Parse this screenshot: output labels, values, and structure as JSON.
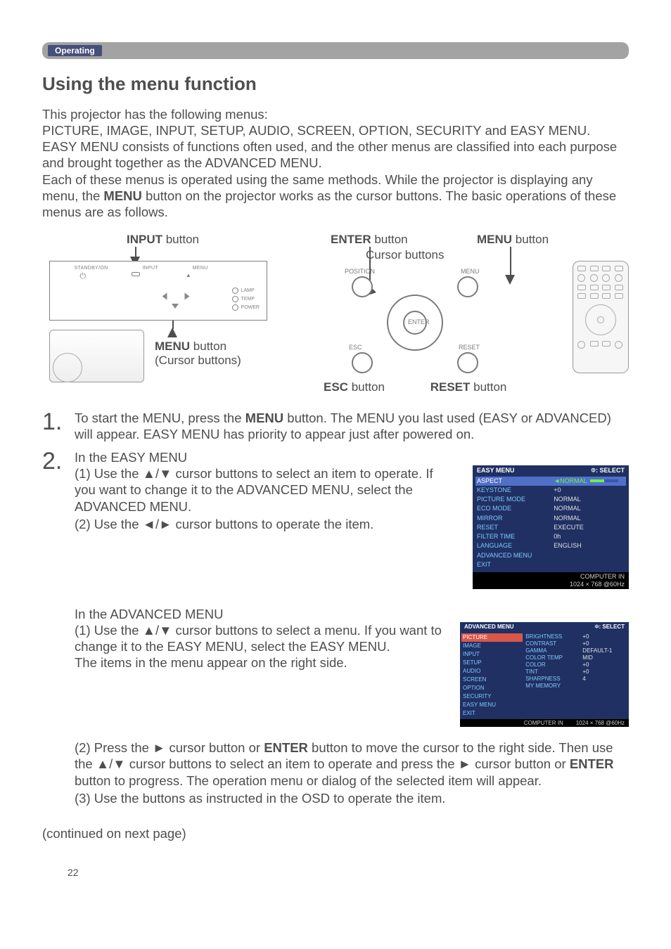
{
  "section_tag": "Operating",
  "title": "Using the menu function",
  "intro": "This projector has the following menus:\nPICTURE, IMAGE, INPUT, SETUP, AUDIO, SCREEN, OPTION, SECURITY and EASY MENU.\nEASY MENU consists of functions often used, and the other menus are classified into each purpose and brought together as the ADVANCED MENU.\nEach of these menus is operated using the same methods. While the projector is displaying any menu, the MENU button on the projector works as the cursor buttons. The basic operations of these menus are as follows.",
  "labels": {
    "input_btn": "INPUT",
    "input_suffix": " button",
    "enter_btn": "ENTER",
    "enter_suffix": " button",
    "menu_btn": "MENU",
    "menu_suffix": " button",
    "cursor_buttons": "Cursor buttons",
    "menu_cursor_line1": "MENU",
    "menu_cursor_suffix": " button",
    "menu_cursor_line2": "(Cursor buttons)",
    "esc_btn": "ESC",
    "esc_suffix": " button",
    "reset_btn": "RESET",
    "reset_suffix": " button"
  },
  "panel": {
    "standby": "STANDBY/ON",
    "input": "INPUT",
    "menu": "MENU",
    "lamp": "LAMP",
    "temp": "TEMP",
    "power": "POWER"
  },
  "cursor_diag": {
    "position": "POSITION",
    "menu": "MENU",
    "enter": "ENTER",
    "esc": "ESC",
    "reset": "RESET"
  },
  "step1_num": "1.",
  "step1_text_pre": "To start the MENU, press the ",
  "step1_text_bold": "MENU",
  "step1_text_post": " button. The MENU you last used (EASY or ADVANCED) will appear. EASY MENU has priority to appear just after powered on.",
  "step2_num": "2.",
  "easy_heading": "In the EASY MENU",
  "easy_1": "(1) Use the ▲/▼ cursor buttons to select an item to operate. If you want to change it to the ADVANCED MENU, select the ADVANCED MENU.",
  "easy_2": "(2) Use the ◄/► cursor buttons to operate the item.",
  "adv_heading": "In the ADVANCED MENU",
  "adv_1a": "(1) Use the ▲/▼ cursor buttons to select a menu. If you want to change it to the EASY MENU, select the EASY MENU.",
  "adv_1b": "The items in the menu appear on the right side.",
  "adv_2a": "(2) Press the ► cursor button or ",
  "adv_2a_bold": "ENTER",
  "adv_2a_post": " button to move the cursor to the right side. Then use the ▲/▼ cursor buttons to select an item to operate and press the ► cursor button or ",
  "adv_2a_bold2": "ENTER",
  "adv_2a_post2": " button to progress. The operation menu or dialog of the selected item will appear.",
  "adv_3": "(3) Use the buttons as instructed in the OSD to operate the item.",
  "easy_menu_shot": {
    "title": "EASY MENU",
    "select": "⯐: SELECT",
    "rows": [
      {
        "k": "ASPECT",
        "v": "◄NORMAL",
        "sel": true,
        "bar": true
      },
      {
        "k": "KEYSTONE",
        "v": "+0"
      },
      {
        "k": "PICTURE MODE",
        "v": "NORMAL"
      },
      {
        "k": "ECO MODE",
        "v": "NORMAL"
      },
      {
        "k": "MIRROR",
        "v": "NORMAL"
      },
      {
        "k": "RESET",
        "v": "EXECUTE"
      },
      {
        "k": "FILTER TIME",
        "v": "0h"
      },
      {
        "k": "LANGUAGE",
        "v": "ENGLISH"
      },
      {
        "k": "ADVANCED MENU",
        "v": ""
      },
      {
        "k": "EXIT",
        "v": ""
      }
    ],
    "foot1": "COMPUTER IN",
    "foot2": "1024 × 768 @60Hz"
  },
  "adv_menu_shot": {
    "title": "ADVANCED MENU",
    "select": "⯐: SELECT",
    "menus": [
      "PICTURE",
      "IMAGE",
      "INPUT",
      "SETUP",
      "AUDIO",
      "SCREEN",
      "OPTION",
      "SECURITY",
      "EASY MENU",
      "EXIT"
    ],
    "sel_index": 0,
    "items": [
      {
        "k": "BRIGHTNESS",
        "v": "+0"
      },
      {
        "k": "CONTRAST",
        "v": "+0"
      },
      {
        "k": "GAMMA",
        "v": "DEFAULT-1"
      },
      {
        "k": "COLOR TEMP",
        "v": "MID"
      },
      {
        "k": "COLOR",
        "v": "+0"
      },
      {
        "k": "TINT",
        "v": "+0"
      },
      {
        "k": "SHARPNESS",
        "v": "4"
      },
      {
        "k": "MY MEMORY",
        "v": ""
      }
    ],
    "foot1": "COMPUTER IN",
    "foot2": "1024 × 768 @60Hz"
  },
  "continued": "(continued on next page)",
  "page_number": "22"
}
